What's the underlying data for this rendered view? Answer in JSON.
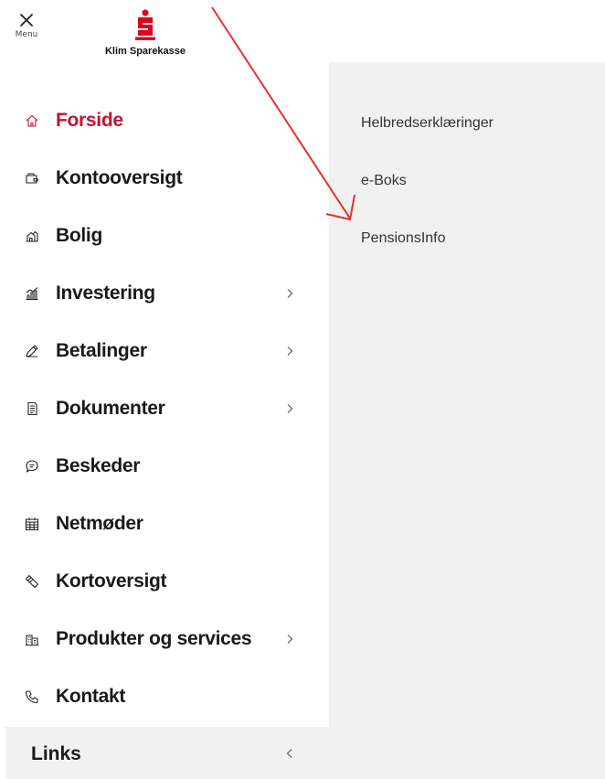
{
  "header": {
    "menu_label": "Menu",
    "logo_text": "Klim Sparekasse",
    "brand_color": "#e2001a"
  },
  "nav": {
    "items": [
      {
        "label": "Forside",
        "icon": "home-icon",
        "active": true
      },
      {
        "label": "Kontooversigt",
        "icon": "wallet-icon"
      },
      {
        "label": "Bolig",
        "icon": "building-icon"
      },
      {
        "label": "Investering",
        "icon": "chart-icon",
        "chevron": true
      },
      {
        "label": "Betalinger",
        "icon": "pen-icon",
        "chevron": true
      },
      {
        "label": "Dokumenter",
        "icon": "document-icon",
        "chevron": true
      },
      {
        "label": "Beskeder",
        "icon": "chat-icon"
      },
      {
        "label": "Netmøder",
        "icon": "calendar-icon"
      },
      {
        "label": "Kortoversigt",
        "icon": "card-icon"
      },
      {
        "label": "Produkter og services",
        "icon": "office-icon",
        "chevron": true
      },
      {
        "label": "Kontakt",
        "icon": "phone-icon"
      }
    ],
    "links_label": "Links",
    "active_color": "#c8102e"
  },
  "submenu": {
    "items": [
      "Helbredserklæringer",
      "e-Boks",
      "PensionsInfo"
    ]
  },
  "annotation": {
    "arrow_color": "#e53030"
  }
}
